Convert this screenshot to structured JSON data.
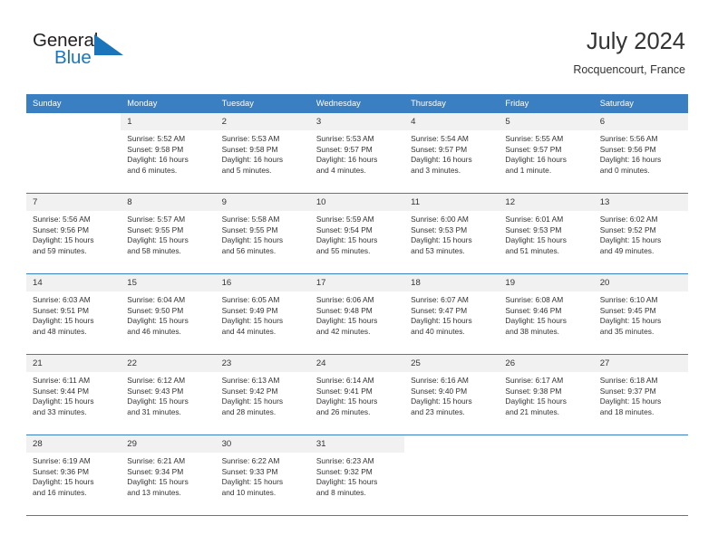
{
  "brand": {
    "name_part1": "General",
    "name_part2": "Blue",
    "flag_icon": "triangle-flag-icon"
  },
  "header": {
    "title": "July 2024",
    "location": "Rocquencourt, France"
  },
  "colors": {
    "header_blue": "#3a7fc1",
    "brand_blue": "#1b75bb",
    "daynum_band": "#f1f1f1",
    "text": "#333333"
  },
  "weekday_headers": [
    "Sunday",
    "Monday",
    "Tuesday",
    "Wednesday",
    "Thursday",
    "Friday",
    "Saturday"
  ],
  "weeks": [
    [
      {
        "day": "",
        "sunrise": "",
        "sunset": "",
        "daylight_line1": "",
        "daylight_line2": ""
      },
      {
        "day": "1",
        "sunrise": "Sunrise: 5:52 AM",
        "sunset": "Sunset: 9:58 PM",
        "daylight_line1": "Daylight: 16 hours",
        "daylight_line2": "and 6 minutes."
      },
      {
        "day": "2",
        "sunrise": "Sunrise: 5:53 AM",
        "sunset": "Sunset: 9:58 PM",
        "daylight_line1": "Daylight: 16 hours",
        "daylight_line2": "and 5 minutes."
      },
      {
        "day": "3",
        "sunrise": "Sunrise: 5:53 AM",
        "sunset": "Sunset: 9:57 PM",
        "daylight_line1": "Daylight: 16 hours",
        "daylight_line2": "and 4 minutes."
      },
      {
        "day": "4",
        "sunrise": "Sunrise: 5:54 AM",
        "sunset": "Sunset: 9:57 PM",
        "daylight_line1": "Daylight: 16 hours",
        "daylight_line2": "and 3 minutes."
      },
      {
        "day": "5",
        "sunrise": "Sunrise: 5:55 AM",
        "sunset": "Sunset: 9:57 PM",
        "daylight_line1": "Daylight: 16 hours",
        "daylight_line2": "and 1 minute."
      },
      {
        "day": "6",
        "sunrise": "Sunrise: 5:56 AM",
        "sunset": "Sunset: 9:56 PM",
        "daylight_line1": "Daylight: 16 hours",
        "daylight_line2": "and 0 minutes."
      }
    ],
    [
      {
        "day": "7",
        "sunrise": "Sunrise: 5:56 AM",
        "sunset": "Sunset: 9:56 PM",
        "daylight_line1": "Daylight: 15 hours",
        "daylight_line2": "and 59 minutes."
      },
      {
        "day": "8",
        "sunrise": "Sunrise: 5:57 AM",
        "sunset": "Sunset: 9:55 PM",
        "daylight_line1": "Daylight: 15 hours",
        "daylight_line2": "and 58 minutes."
      },
      {
        "day": "9",
        "sunrise": "Sunrise: 5:58 AM",
        "sunset": "Sunset: 9:55 PM",
        "daylight_line1": "Daylight: 15 hours",
        "daylight_line2": "and 56 minutes."
      },
      {
        "day": "10",
        "sunrise": "Sunrise: 5:59 AM",
        "sunset": "Sunset: 9:54 PM",
        "daylight_line1": "Daylight: 15 hours",
        "daylight_line2": "and 55 minutes."
      },
      {
        "day": "11",
        "sunrise": "Sunrise: 6:00 AM",
        "sunset": "Sunset: 9:53 PM",
        "daylight_line1": "Daylight: 15 hours",
        "daylight_line2": "and 53 minutes."
      },
      {
        "day": "12",
        "sunrise": "Sunrise: 6:01 AM",
        "sunset": "Sunset: 9:53 PM",
        "daylight_line1": "Daylight: 15 hours",
        "daylight_line2": "and 51 minutes."
      },
      {
        "day": "13",
        "sunrise": "Sunrise: 6:02 AM",
        "sunset": "Sunset: 9:52 PM",
        "daylight_line1": "Daylight: 15 hours",
        "daylight_line2": "and 49 minutes."
      }
    ],
    [
      {
        "day": "14",
        "sunrise": "Sunrise: 6:03 AM",
        "sunset": "Sunset: 9:51 PM",
        "daylight_line1": "Daylight: 15 hours",
        "daylight_line2": "and 48 minutes."
      },
      {
        "day": "15",
        "sunrise": "Sunrise: 6:04 AM",
        "sunset": "Sunset: 9:50 PM",
        "daylight_line1": "Daylight: 15 hours",
        "daylight_line2": "and 46 minutes."
      },
      {
        "day": "16",
        "sunrise": "Sunrise: 6:05 AM",
        "sunset": "Sunset: 9:49 PM",
        "daylight_line1": "Daylight: 15 hours",
        "daylight_line2": "and 44 minutes."
      },
      {
        "day": "17",
        "sunrise": "Sunrise: 6:06 AM",
        "sunset": "Sunset: 9:48 PM",
        "daylight_line1": "Daylight: 15 hours",
        "daylight_line2": "and 42 minutes."
      },
      {
        "day": "18",
        "sunrise": "Sunrise: 6:07 AM",
        "sunset": "Sunset: 9:47 PM",
        "daylight_line1": "Daylight: 15 hours",
        "daylight_line2": "and 40 minutes."
      },
      {
        "day": "19",
        "sunrise": "Sunrise: 6:08 AM",
        "sunset": "Sunset: 9:46 PM",
        "daylight_line1": "Daylight: 15 hours",
        "daylight_line2": "and 38 minutes."
      },
      {
        "day": "20",
        "sunrise": "Sunrise: 6:10 AM",
        "sunset": "Sunset: 9:45 PM",
        "daylight_line1": "Daylight: 15 hours",
        "daylight_line2": "and 35 minutes."
      }
    ],
    [
      {
        "day": "21",
        "sunrise": "Sunrise: 6:11 AM",
        "sunset": "Sunset: 9:44 PM",
        "daylight_line1": "Daylight: 15 hours",
        "daylight_line2": "and 33 minutes."
      },
      {
        "day": "22",
        "sunrise": "Sunrise: 6:12 AM",
        "sunset": "Sunset: 9:43 PM",
        "daylight_line1": "Daylight: 15 hours",
        "daylight_line2": "and 31 minutes."
      },
      {
        "day": "23",
        "sunrise": "Sunrise: 6:13 AM",
        "sunset": "Sunset: 9:42 PM",
        "daylight_line1": "Daylight: 15 hours",
        "daylight_line2": "and 28 minutes."
      },
      {
        "day": "24",
        "sunrise": "Sunrise: 6:14 AM",
        "sunset": "Sunset: 9:41 PM",
        "daylight_line1": "Daylight: 15 hours",
        "daylight_line2": "and 26 minutes."
      },
      {
        "day": "25",
        "sunrise": "Sunrise: 6:16 AM",
        "sunset": "Sunset: 9:40 PM",
        "daylight_line1": "Daylight: 15 hours",
        "daylight_line2": "and 23 minutes."
      },
      {
        "day": "26",
        "sunrise": "Sunrise: 6:17 AM",
        "sunset": "Sunset: 9:38 PM",
        "daylight_line1": "Daylight: 15 hours",
        "daylight_line2": "and 21 minutes."
      },
      {
        "day": "27",
        "sunrise": "Sunrise: 6:18 AM",
        "sunset": "Sunset: 9:37 PM",
        "daylight_line1": "Daylight: 15 hours",
        "daylight_line2": "and 18 minutes."
      }
    ],
    [
      {
        "day": "28",
        "sunrise": "Sunrise: 6:19 AM",
        "sunset": "Sunset: 9:36 PM",
        "daylight_line1": "Daylight: 15 hours",
        "daylight_line2": "and 16 minutes."
      },
      {
        "day": "29",
        "sunrise": "Sunrise: 6:21 AM",
        "sunset": "Sunset: 9:34 PM",
        "daylight_line1": "Daylight: 15 hours",
        "daylight_line2": "and 13 minutes."
      },
      {
        "day": "30",
        "sunrise": "Sunrise: 6:22 AM",
        "sunset": "Sunset: 9:33 PM",
        "daylight_line1": "Daylight: 15 hours",
        "daylight_line2": "and 10 minutes."
      },
      {
        "day": "31",
        "sunrise": "Sunrise: 6:23 AM",
        "sunset": "Sunset: 9:32 PM",
        "daylight_line1": "Daylight: 15 hours",
        "daylight_line2": "and 8 minutes."
      },
      {
        "day": "",
        "sunrise": "",
        "sunset": "",
        "daylight_line1": "",
        "daylight_line2": ""
      },
      {
        "day": "",
        "sunrise": "",
        "sunset": "",
        "daylight_line1": "",
        "daylight_line2": ""
      },
      {
        "day": "",
        "sunrise": "",
        "sunset": "",
        "daylight_line1": "",
        "daylight_line2": ""
      }
    ]
  ]
}
